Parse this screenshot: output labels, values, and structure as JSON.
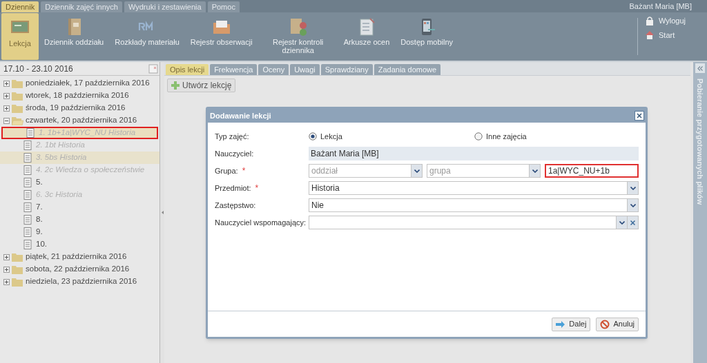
{
  "menu_tabs": [
    {
      "label": "Dziennik",
      "selected": true
    },
    {
      "label": "Dziennik zajęć innych",
      "selected": false
    },
    {
      "label": "Wydruki i zestawienia",
      "selected": false
    },
    {
      "label": "Pomoc",
      "selected": false
    }
  ],
  "user": "Bażant Maria [MB]",
  "toolbar": [
    {
      "label": "Lekcja",
      "kind": "board",
      "selected": true
    },
    {
      "label": "Dziennik oddziału",
      "kind": "book",
      "selected": false
    },
    {
      "label": "Rozkłady materiału",
      "kind": "rm",
      "selected": false
    },
    {
      "label": "Rejestr obserwacji",
      "kind": "folder",
      "selected": false
    },
    {
      "label": "Rejestr kontroli dziennika",
      "kind": "check",
      "selected": false
    },
    {
      "label": "Arkusze ocen",
      "kind": "sheet",
      "selected": false
    },
    {
      "label": "Dostęp mobilny",
      "kind": "phone",
      "selected": false
    }
  ],
  "account_links": [
    {
      "label": "Wyloguj",
      "kind": "lock"
    },
    {
      "label": "Start",
      "kind": "home"
    }
  ],
  "week": "17.10 - 23.10 2016",
  "tree": [
    {
      "label": "poniedziałek, 17 października 2016",
      "expanded": false
    },
    {
      "label": "wtorek, 18 października 2016",
      "expanded": false
    },
    {
      "label": "środa, 19 października 2016",
      "expanded": false
    },
    {
      "label": "czwartek, 20 października 2016",
      "expanded": true,
      "children": [
        {
          "label": "1. 1b+1a|WYC_NU Historia",
          "dimmed": true,
          "selected": true,
          "highlighted": false
        },
        {
          "label": "2. 1bt Historia",
          "dimmed": true,
          "selected": false,
          "highlighted": false
        },
        {
          "label": "3. 5bs Historia",
          "dimmed": true,
          "selected": false,
          "highlighted": true
        },
        {
          "label": "4. 2c Wiedza o społeczeństwie",
          "dimmed": true,
          "selected": false,
          "highlighted": false
        },
        {
          "label": "5.",
          "dimmed": false,
          "selected": false,
          "highlighted": false
        },
        {
          "label": "6. 3c Historia",
          "dimmed": true,
          "selected": false,
          "highlighted": false
        },
        {
          "label": "7.",
          "dimmed": false,
          "selected": false,
          "highlighted": false
        },
        {
          "label": "8.",
          "dimmed": false,
          "selected": false,
          "highlighted": false
        },
        {
          "label": "9.",
          "dimmed": false,
          "selected": false,
          "highlighted": false
        },
        {
          "label": "10.",
          "dimmed": false,
          "selected": false,
          "highlighted": false
        }
      ]
    },
    {
      "label": "piątek, 21 października 2016",
      "expanded": false
    },
    {
      "label": "sobota, 22 października 2016",
      "expanded": false
    },
    {
      "label": "niedziela, 23 października 2016",
      "expanded": false
    }
  ],
  "content_tabs": [
    {
      "label": "Opis lekcji",
      "selected": true
    },
    {
      "label": "Frekwencja",
      "selected": false
    },
    {
      "label": "Oceny",
      "selected": false
    },
    {
      "label": "Uwagi",
      "selected": false
    },
    {
      "label": "Sprawdziany",
      "selected": false
    },
    {
      "label": "Zadania domowe",
      "selected": false
    }
  ],
  "create_button": "Utwórz lekcję",
  "side_panel": "Pobieranie przygotowanych plików",
  "dialog": {
    "title": "Dodawanie lekcji",
    "type_row": {
      "label": "Typ zajęć:",
      "options": [
        {
          "label": "Lekcja",
          "selected": true
        },
        {
          "label": "Inne zajęcia",
          "selected": false
        }
      ]
    },
    "teacher": {
      "label": "Nauczyciel:",
      "value": "Bażant Maria [MB]"
    },
    "group": {
      "label": "Grupa:",
      "required_mark": "*",
      "placeholders": [
        "oddział",
        "grupa"
      ],
      "value": "1a|WYC_NU+1b",
      "error": true
    },
    "fields": [
      {
        "label": "Przedmiot:",
        "required_mark": "*",
        "value": "Historia",
        "clearable": false
      },
      {
        "label": "Zastępstwo:",
        "value": "Nie",
        "clearable": false
      },
      {
        "label": "Nauczyciel wspomagający:",
        "clearable": true
      }
    ],
    "buttons": [
      {
        "label": "Dalej",
        "kind": "next"
      },
      {
        "label": "Anuluj",
        "kind": "cancel"
      }
    ]
  }
}
